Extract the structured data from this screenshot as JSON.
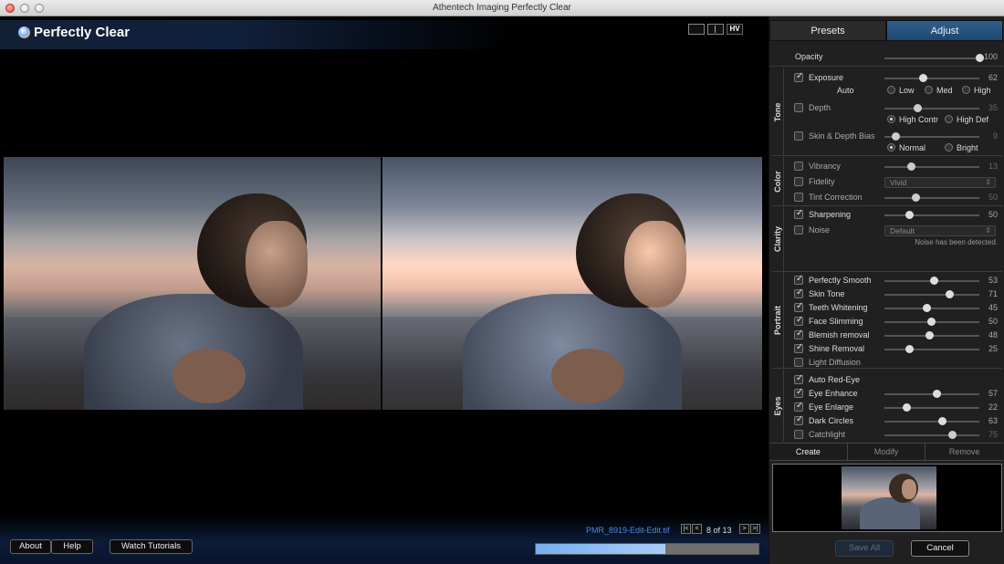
{
  "window": {
    "title": "Athentech Imaging Perfectly Clear"
  },
  "header": {
    "logo_text": "Perfectly Clear",
    "view_buttons": [
      {
        "icon": "single-view-icon"
      },
      {
        "icon": "split-view-icon"
      },
      {
        "icon": "side-by-side-view-icon"
      },
      {
        "label": "HV"
      }
    ]
  },
  "file": {
    "name": "PMR_8919-Edit-Edit.tif",
    "counter": "8 of 13",
    "nav_first": "|<",
    "nav_prev": "<",
    "nav_next": ">",
    "nav_last": ">|"
  },
  "progress": {
    "value": 0.58
  },
  "bottom": {
    "about": "About",
    "help": "Help",
    "tutorials": "Watch Tutorials"
  },
  "tabs": {
    "presets": "Presets",
    "adjust": "Adjust"
  },
  "opacity": {
    "label": "Opacity",
    "value": "100",
    "level": 1.0
  },
  "sections": {
    "tone": "Tone",
    "color": "Color",
    "clarity": "Clarity",
    "portrait": "Portrait",
    "eyes": "Eyes"
  },
  "tone": {
    "exposure": {
      "label": "Exposure",
      "value": "62",
      "level": 0.4,
      "checked": true
    },
    "auto": {
      "label": "Auto",
      "low": "Low",
      "med": "Med",
      "high": "High"
    },
    "depth": {
      "label": "Depth",
      "value": "35",
      "level": 0.35,
      "checked": false
    },
    "depth_opts": {
      "a": "High Contr",
      "b": "High Def"
    },
    "skin_bias": {
      "label": "Skin & Depth Bias",
      "value": "9",
      "level": 0.12,
      "checked": false
    },
    "skin_opts": {
      "a": "Normal",
      "b": "Bright"
    }
  },
  "color": {
    "vibrancy": {
      "label": "Vibrancy",
      "value": "13",
      "level": 0.28,
      "checked": false
    },
    "fidelity": {
      "label": "Fidelity",
      "select": "Vivid",
      "checked": false
    },
    "tint": {
      "label": "Tint Correction",
      "value": "50",
      "level": 0.33,
      "checked": false
    }
  },
  "clarity": {
    "sharpening": {
      "label": "Sharpening",
      "value": "50",
      "level": 0.26,
      "checked": true
    },
    "noise": {
      "label": "Noise",
      "select": "Default",
      "checked": false
    },
    "note": "Noise has been detected."
  },
  "portrait": [
    {
      "label": "Perfectly Smooth",
      "value": "53",
      "level": 0.52,
      "checked": true
    },
    {
      "label": "Skin Tone",
      "value": "71",
      "level": 0.68,
      "checked": true
    },
    {
      "label": "Teeth Whitening",
      "value": "45",
      "level": 0.44,
      "checked": true
    },
    {
      "label": "Face Slimming",
      "value": "50",
      "level": 0.49,
      "checked": true
    },
    {
      "label": "Blemish removal",
      "value": "48",
      "level": 0.47,
      "checked": true
    },
    {
      "label": "Shine Removal",
      "value": "25",
      "level": 0.26,
      "checked": true
    },
    {
      "label": "Light Diffusion",
      "checked": false
    }
  ],
  "eyes": [
    {
      "label": "Auto Red-Eye",
      "checked": true
    },
    {
      "label": "Eye Enhance",
      "value": "57",
      "level": 0.55,
      "checked": true
    },
    {
      "label": "Eye Enlarge",
      "value": "22",
      "level": 0.23,
      "checked": true
    },
    {
      "label": "Dark Circles",
      "value": "63",
      "level": 0.61,
      "checked": true
    },
    {
      "label": "Catchlight",
      "value": "75",
      "level": 0.71,
      "checked": false
    }
  ],
  "preset_actions": {
    "create": "Create",
    "modify": "Modify",
    "remove": "Remove"
  },
  "footer": {
    "save_all": "Save All",
    "cancel": "Cancel"
  },
  "colors": {
    "accent": "#2f5f8e",
    "progress": "#8fbdf2",
    "filename": "#4a88e8"
  }
}
